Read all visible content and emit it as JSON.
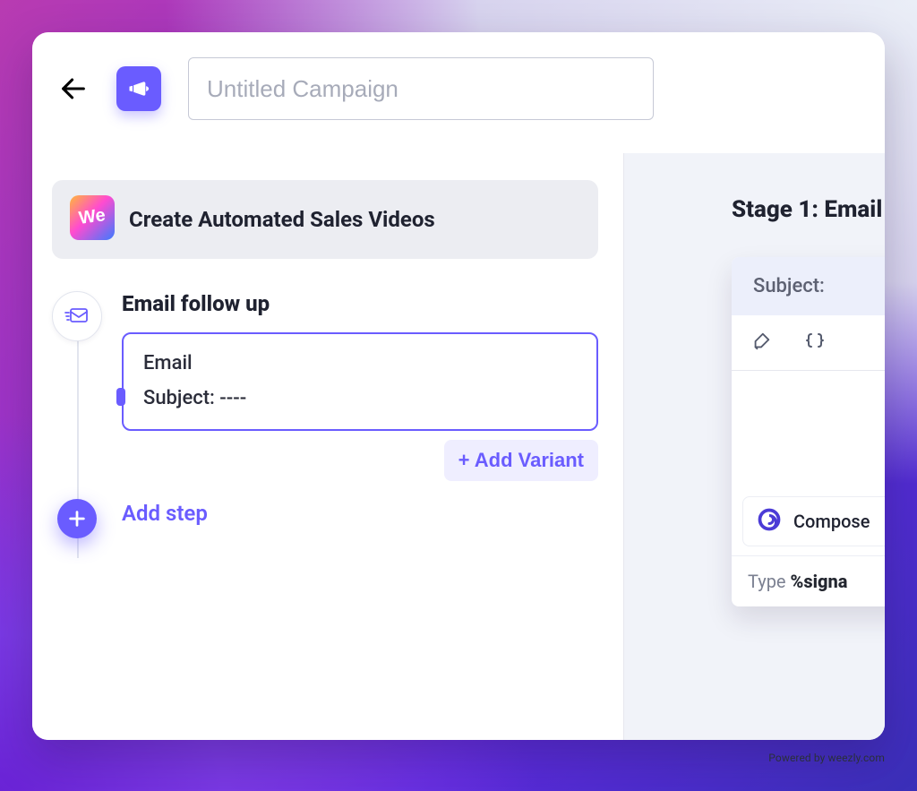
{
  "header": {
    "campaign_placeholder": "Untitled Campaign"
  },
  "banner": {
    "text": "Create Automated Sales Videos"
  },
  "step1": {
    "title": "Email follow up",
    "card": {
      "heading": "Email",
      "subject_line": "Subject: ----"
    },
    "add_variant_label": "+ Add Variant"
  },
  "add_step_label": "Add step",
  "right": {
    "stage_title": "Stage 1: Email",
    "subject_label": "Subject:",
    "compose_label": "Compose",
    "signature_prefix": "Type ",
    "signature_token": "%signa"
  },
  "credit": "Powered by weezly.com"
}
